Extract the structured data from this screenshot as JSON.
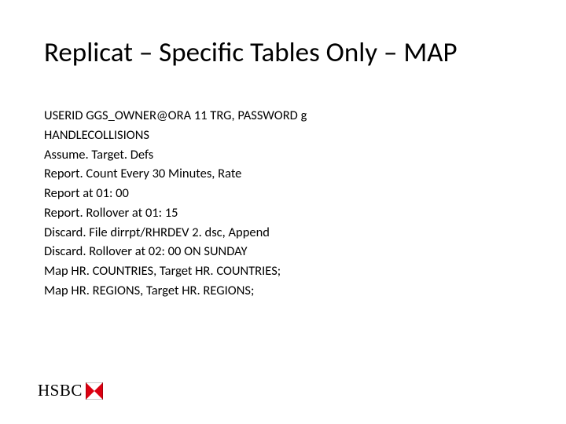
{
  "title": "Replicat – Specific Tables Only – MAP",
  "lines": [
    "USERID GGS_OWNER@ORA 11 TRG, PASSWORD g",
    "HANDLECOLLISIONS",
    "Assume. Target. Defs",
    "Report. Count Every 30 Minutes, Rate",
    "Report at 01: 00",
    "Report. Rollover at 01: 15",
    "Discard. File dirrpt/RHRDEV 2. dsc, Append",
    "Discard. Rollover at 02: 00 ON SUNDAY",
    "Map HR. COUNTRIES, Target HR. COUNTRIES;",
    "Map HR. REGIONS, Target HR. REGIONS;"
  ],
  "logo": {
    "text": "HSBC",
    "icon_name": "hsbc-hexagon-icon"
  }
}
